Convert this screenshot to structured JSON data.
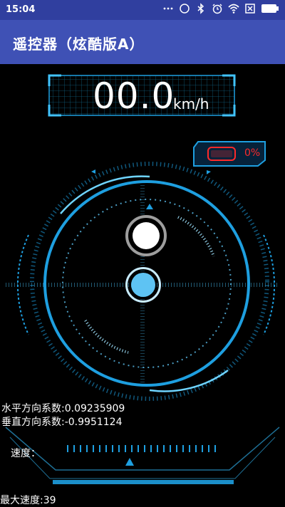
{
  "status_bar": {
    "time": "15:04",
    "icons": [
      "more-dots-icon",
      "clock-icon",
      "bluetooth-icon",
      "alarm-icon",
      "wifi-icon",
      "sim-x-icon",
      "battery-icon"
    ]
  },
  "app_bar": {
    "title": "遥控器（炫酷版A）"
  },
  "speedometer": {
    "value": "00.0",
    "unit": "km/h"
  },
  "battery": {
    "percent_label": "0%",
    "percent": 0
  },
  "joystick": {
    "horizontal_label": "水平方向系数:0.09235909",
    "vertical_label": "垂直方向系数:-0.9951124"
  },
  "speed_control": {
    "label": "速度：",
    "value": 0.5
  },
  "max_speed": {
    "label": "最大速度:39"
  },
  "colors": {
    "accent": "#1e9fe0",
    "app_bar": "#3f51b5",
    "status_bar": "#303f9f",
    "battery_alert": "#ff2a2a",
    "knob": "#5ec3f3"
  }
}
